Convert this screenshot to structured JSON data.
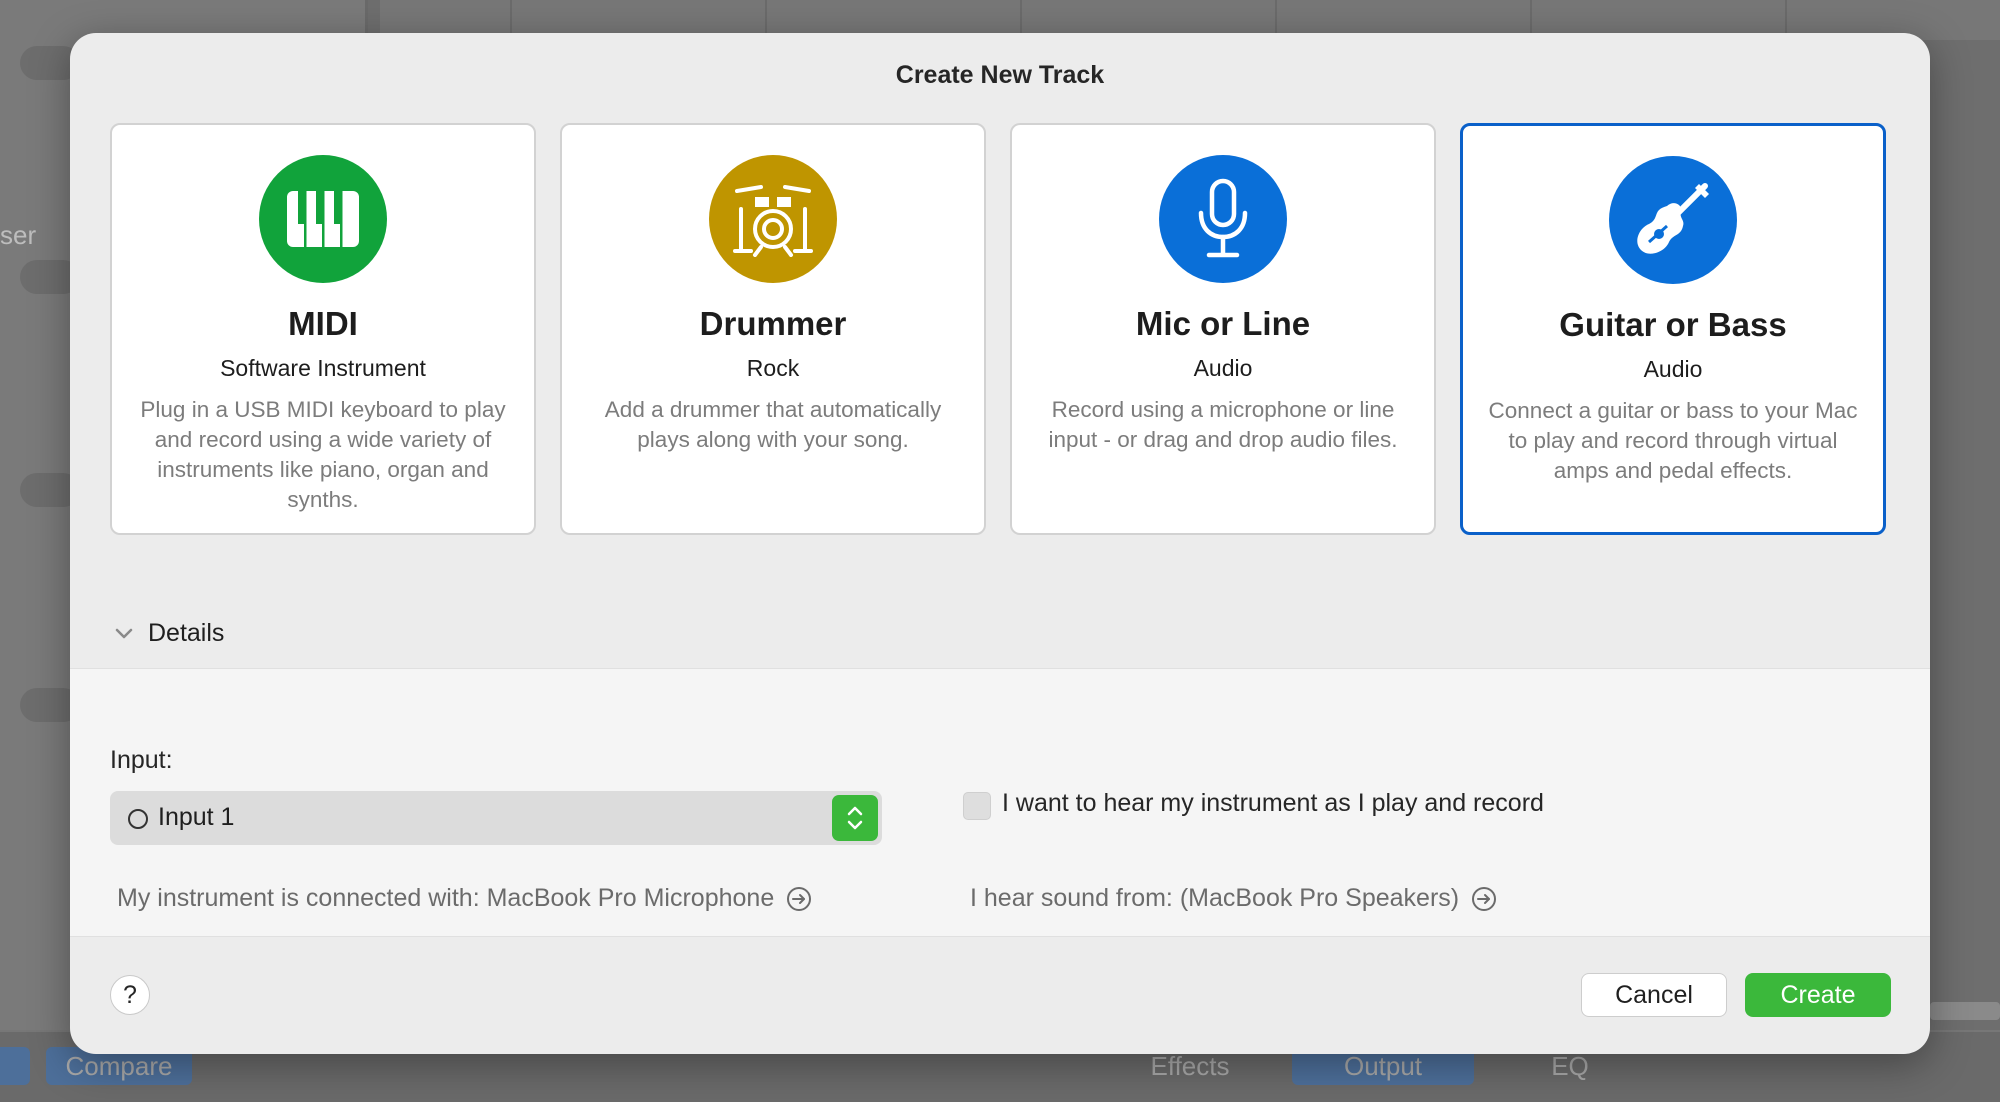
{
  "background": {
    "side_label": "ser",
    "bottom_tabs": [
      "Compare",
      "Effects",
      "Output",
      "EQ"
    ]
  },
  "dialog": {
    "title": "Create New Track",
    "cards": [
      {
        "id": "midi",
        "title": "MIDI",
        "subtitle": "Software Instrument",
        "description": "Plug in a USB MIDI keyboard to play and record using a wide variety of instruments like piano, organ and synths.",
        "icon": "piano-keys-icon",
        "color": "#11a33b",
        "selected": false
      },
      {
        "id": "drummer",
        "title": "Drummer",
        "subtitle": "Rock",
        "description": "Add a drummer that automatically plays along with your song.",
        "icon": "drum-kit-icon",
        "color": "#bf9500",
        "selected": false
      },
      {
        "id": "mic",
        "title": "Mic or Line",
        "subtitle": "Audio",
        "description": "Record using a microphone or line input - or drag and drop audio files.",
        "icon": "microphone-icon",
        "color": "#0a6fd8",
        "selected": false
      },
      {
        "id": "guitar",
        "title": "Guitar or Bass",
        "subtitle": "Audio",
        "description": "Connect a guitar or bass to your Mac to play and record through virtual amps and pedal effects.",
        "icon": "guitar-icon",
        "color": "#0a6fd8",
        "selected": true
      }
    ],
    "details": {
      "label": "Details",
      "expanded": true,
      "input_label": "Input:",
      "input_value": "Input 1",
      "monitor_label": "I want to hear my instrument as I play and record",
      "monitor_checked": false,
      "connected_with": "My instrument is connected with: MacBook Pro Microphone",
      "hear_from": "I hear sound from: (MacBook Pro Speakers)"
    },
    "buttons": {
      "help": "?",
      "cancel": "Cancel",
      "create": "Create"
    }
  },
  "colors": {
    "accent_blue": "#0a60c9",
    "create_green": "#3bb83b"
  }
}
